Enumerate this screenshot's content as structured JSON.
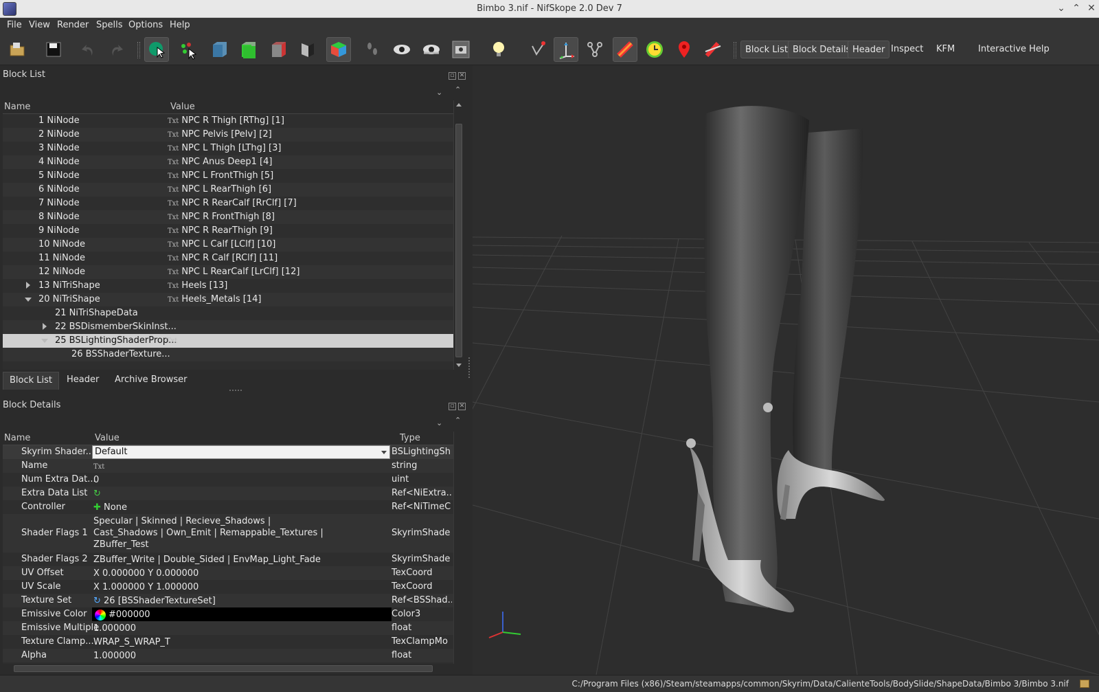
{
  "window": {
    "title": "Bimbo 3.nif - NifSkope 2.0 Dev 7"
  },
  "menubar": [
    "File",
    "View",
    "Render",
    "Spells",
    "Options",
    "Help"
  ],
  "toolbar": {
    "icons": [
      "open-icon",
      "save-icon",
      "undo-icon",
      "redo-icon",
      "select-object-icon",
      "select-vertex-icon",
      "view-front-icon",
      "view-side-icon",
      "view-top-icon",
      "view-walk-icon",
      "view-perspective-icon",
      "footsteps-icon",
      "eye-icon",
      "eye-hidden-icon",
      "screenshot-icon",
      "light-bulb-icon",
      "pointer-icon",
      "axes-icon",
      "node-tree-icon",
      "texture-icon",
      "clock-icon",
      "pin-icon",
      "no-draw-icon"
    ],
    "text_buttons": [
      "Block List",
      "Block Details",
      "Header",
      "Inspect",
      "KFM",
      "Interactive Help"
    ]
  },
  "block_list": {
    "title": "Block List",
    "columns": [
      "Name",
      "Value"
    ],
    "rows": [
      {
        "name": "1 NiNode",
        "value": "NPC R Thigh [RThg] [1]"
      },
      {
        "name": "2 NiNode",
        "value": "NPC Pelvis [Pelv] [2]"
      },
      {
        "name": "3 NiNode",
        "value": "NPC L Thigh [LThg] [3]"
      },
      {
        "name": "4 NiNode",
        "value": "NPC Anus Deep1 [4]"
      },
      {
        "name": "5 NiNode",
        "value": "NPC L FrontThigh [5]"
      },
      {
        "name": "6 NiNode",
        "value": "NPC L RearThigh [6]"
      },
      {
        "name": "7 NiNode",
        "value": "NPC R RearCalf [RrClf] [7]"
      },
      {
        "name": "8 NiNode",
        "value": "NPC R FrontThigh [8]"
      },
      {
        "name": "9 NiNode",
        "value": "NPC R RearThigh [9]"
      },
      {
        "name": "10 NiNode",
        "value": "NPC L Calf [LClf] [10]"
      },
      {
        "name": "11 NiNode",
        "value": "NPC R Calf [RClf] [11]"
      },
      {
        "name": "12 NiNode",
        "value": "NPC L RearCalf [LrClf] [12]"
      },
      {
        "name": "13 NiTriShape",
        "value": "Heels [13]"
      },
      {
        "name": "20 NiTriShape",
        "value": "Heels_Metals [14]"
      },
      {
        "name": "21 NiTriShapeData",
        "value": ""
      },
      {
        "name": "22 BSDismemberSkinInst...",
        "value": ""
      },
      {
        "name": "25 BSLightingShaderProp...",
        "value": ""
      },
      {
        "name": "26 BSShaderTexture...",
        "value": ""
      }
    ],
    "tabs": [
      "Block List",
      "Header",
      "Archive Browser"
    ]
  },
  "block_details": {
    "title": "Block Details",
    "columns": [
      "Name",
      "Value",
      "Type"
    ],
    "combo_value": "Default",
    "rows": [
      {
        "name": "Skyrim Shader...",
        "value": "",
        "type": "BSLightingSh"
      },
      {
        "name": "Name",
        "value": "",
        "type": "string"
      },
      {
        "name": "Num Extra Dat...",
        "value": "0",
        "type": "uint"
      },
      {
        "name": "Extra Data List",
        "value": "",
        "type": "Ref<NiExtra..."
      },
      {
        "name": "Controller",
        "value": "None",
        "type": "Ref<NiTimeC"
      },
      {
        "name": "Shader Flags 1",
        "value": "Specular | Skinned | Recieve_Shadows |",
        "value2": "Cast_Shadows | Own_Emit | Remappable_Textures |",
        "value3": "ZBuffer_Test",
        "type": "SkyrimShade"
      },
      {
        "name": "Shader Flags 2",
        "value": "ZBuffer_Write | Double_Sided | EnvMap_Light_Fade",
        "type": "SkyrimShade"
      },
      {
        "name": "UV Offset",
        "value": "X 0.000000 Y 0.000000",
        "type": "TexCoord"
      },
      {
        "name": "UV Scale",
        "value": "X 1.000000 Y 1.000000",
        "type": "TexCoord"
      },
      {
        "name": "Texture Set",
        "value": "26 [BSShaderTextureSet]",
        "type": "Ref<BSShad..."
      },
      {
        "name": "Emissive Color",
        "value": "#000000",
        "type": "Color3"
      },
      {
        "name": "Emissive Multiple",
        "value": "1.000000",
        "type": "float"
      },
      {
        "name": "Texture Clamp...",
        "value": "WRAP_S_WRAP_T",
        "type": "TexClampMo"
      },
      {
        "name": "Alpha",
        "value": "1.000000",
        "type": "float"
      }
    ]
  },
  "status": {
    "path": "C:/Program Files (x86)/Steam/steamapps/common/Skyrim/Data/CalienteTools/BodySlide/ShapeData/Bimbo 3/Bimbo 3.nif"
  }
}
